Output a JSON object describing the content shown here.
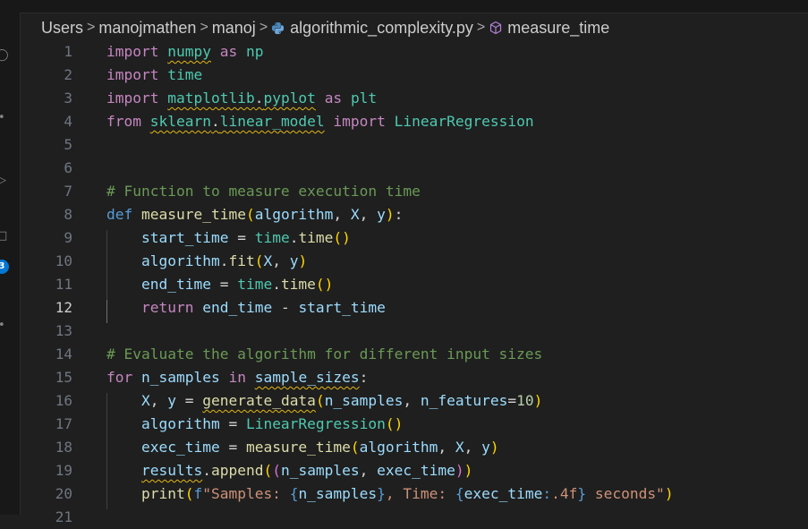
{
  "breadcrumb": {
    "items": [
      "Users",
      "manojmathen",
      "manoj",
      "algorithmic_complexity.py",
      "measure_time"
    ],
    "separator": ">"
  },
  "activity_bar": {
    "badge_count": "3"
  },
  "editor": {
    "active_line": 12,
    "lines": [
      {
        "n": "1",
        "text": "import numpy as np"
      },
      {
        "n": "2",
        "text": "import time"
      },
      {
        "n": "3",
        "text": "import matplotlib.pyplot as plt"
      },
      {
        "n": "4",
        "text": "from sklearn.linear_model import LinearRegression"
      },
      {
        "n": "5",
        "text": ""
      },
      {
        "n": "6",
        "text": ""
      },
      {
        "n": "7",
        "text": "# Function to measure execution time"
      },
      {
        "n": "8",
        "text": "def measure_time(algorithm, X, y):"
      },
      {
        "n": "9",
        "text": "    start_time = time.time()"
      },
      {
        "n": "10",
        "text": "    algorithm.fit(X, y)"
      },
      {
        "n": "11",
        "text": "    end_time = time.time()"
      },
      {
        "n": "12",
        "text": "    return end_time - start_time"
      },
      {
        "n": "13",
        "text": ""
      },
      {
        "n": "14",
        "text": "# Evaluate the algorithm for different input sizes"
      },
      {
        "n": "15",
        "text": "for n_samples in sample_sizes:"
      },
      {
        "n": "16",
        "text": "    X, y = generate_data(n_samples, n_features=10)"
      },
      {
        "n": "17",
        "text": "    algorithm = LinearRegression()"
      },
      {
        "n": "18",
        "text": "    exec_time = measure_time(algorithm, X, y)"
      },
      {
        "n": "19",
        "text": "    results.append((n_samples, exec_time))"
      },
      {
        "n": "20",
        "text": "    print(f\"Samples: {n_samples}, Time: {exec_time:.4f} seconds\")"
      },
      {
        "n": "21",
        "text": ""
      }
    ]
  }
}
